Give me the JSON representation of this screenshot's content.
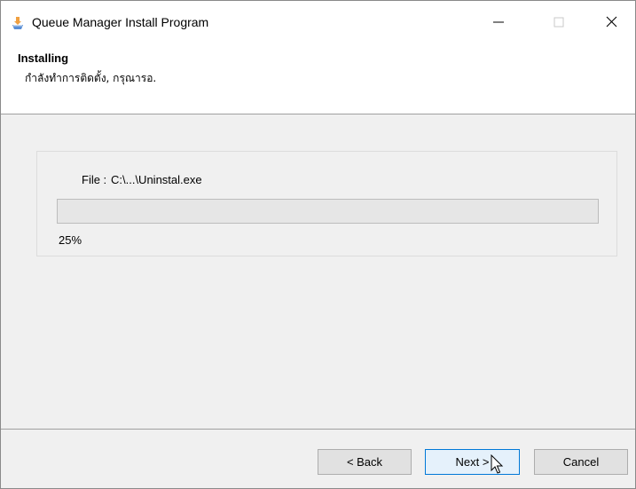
{
  "window": {
    "title": "Queue Manager Install Program"
  },
  "header": {
    "title": "Installing",
    "subtitle": "กำลังทำการติดตั้ง, กรุณารอ."
  },
  "progress": {
    "file_label": "File :",
    "file_value": "C:\\...\\Uninstal.exe",
    "percent_text": "25%",
    "fraction": 0.25
  },
  "buttons": {
    "back": "< Back",
    "next": "Next >",
    "cancel": "Cancel"
  },
  "icons": {
    "app": "installer-app-icon",
    "minimize": "minimize-icon",
    "maximize": "maximize-icon",
    "close": "close-icon",
    "cursor": "mouse-pointer-icon"
  }
}
